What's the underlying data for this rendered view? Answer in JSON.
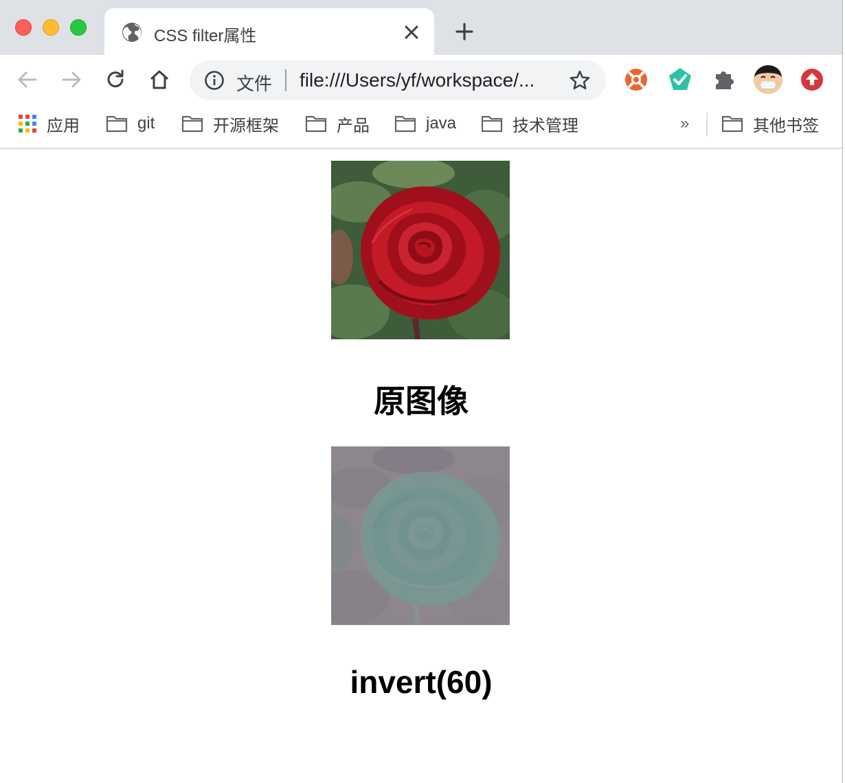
{
  "window": {
    "controls": [
      "close",
      "minimize",
      "maximize"
    ]
  },
  "tab": {
    "title": "CSS filter属性",
    "icon": "globe-icon"
  },
  "toolbar": {
    "omnibox": {
      "scheme_label": "文件",
      "url": "file:///Users/yf/workspace/..."
    },
    "extensions": [
      "orange-lifebuoy-icon",
      "teal-check-icon",
      "puzzle-icon",
      "avatar",
      "red-upload-icon"
    ]
  },
  "bookmarks": {
    "apps_label": "应用",
    "items": [
      {
        "label": "git"
      },
      {
        "label": "开源框架"
      },
      {
        "label": "产品"
      },
      {
        "label": "java"
      },
      {
        "label": "技术管理"
      }
    ],
    "more": "»",
    "other": "其他书签"
  },
  "page": {
    "caption_original": "原图像",
    "caption_filtered": "invert(60)"
  },
  "colors": {
    "tabstrip": "#dee1e6",
    "rose_red": "#b3121f",
    "leaf_green": "#3e5b3a"
  }
}
